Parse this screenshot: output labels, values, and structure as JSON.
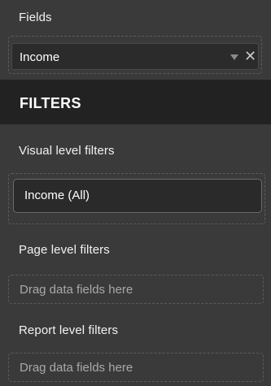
{
  "fields": {
    "section_label": "Fields",
    "chip_label": "Income"
  },
  "filters": {
    "header_title": "FILTERS",
    "visual_level": {
      "label": "Visual level filters",
      "chip_label": "Income  (All)"
    },
    "page_level": {
      "label": "Page level filters",
      "drop_placeholder": "Drag data fields here"
    },
    "report_level": {
      "label": "Report level filters",
      "drop_placeholder": "Drag data fields here"
    }
  },
  "icons": {
    "dropdown": "chevron-down-icon",
    "remove": "close-icon"
  },
  "colors": {
    "panel_bg": "#3a3a3a",
    "header_bg": "#222222",
    "chip_bg": "#2b2b2b",
    "placeholder_text": "#a9a9a9"
  }
}
